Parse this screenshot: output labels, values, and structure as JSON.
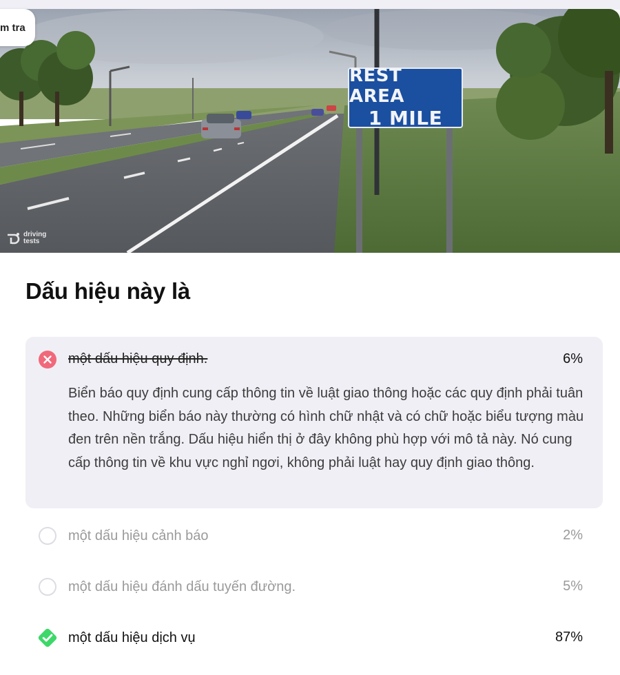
{
  "header": {
    "chip_label": "m tra"
  },
  "image": {
    "sign_line1": "REST AREA",
    "sign_line2": "1 MILE",
    "logo_line1": "driving",
    "logo_line2": "tests"
  },
  "question": {
    "title": "Dấu hiệu này là"
  },
  "answers": [
    {
      "label": "một dấu hiệu quy định.",
      "percent": "6%",
      "state": "incorrect-selected",
      "explanation": "Biển báo quy định cung cấp thông tin về luật giao thông hoặc các quy định phải tuân theo. Những biển báo này thường có hình chữ nhật và có chữ hoặc biểu tượng màu đen trên nền trắng. Dấu hiệu hiển thị ở đây không phù hợp với mô tả này. Nó cung cấp thông tin về khu vực nghỉ ngơi, không phải luật hay quy định giao thông."
    },
    {
      "label": "một dấu hiệu cảnh báo",
      "percent": "2%",
      "state": "unselected"
    },
    {
      "label": "một dấu hiệu đánh dấu tuyến đường.",
      "percent": "5%",
      "state": "unselected"
    },
    {
      "label": "một dấu hiệu dịch vụ",
      "percent": "87%",
      "state": "correct"
    }
  ],
  "colors": {
    "incorrect": "#f0697a",
    "correct": "#3ed86a",
    "selected_bg": "#f0eff5",
    "sign_blue": "#1b4fa0"
  }
}
